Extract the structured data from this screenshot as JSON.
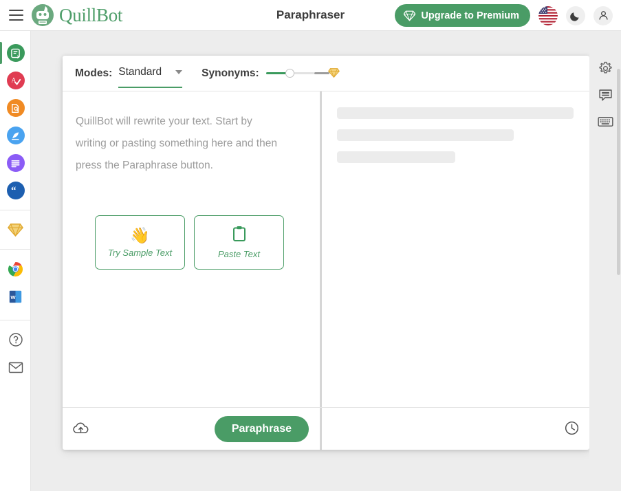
{
  "topbar": {
    "menu_icon": "hamburger-menu-icon",
    "brand_name": "QuillBot",
    "brand_logo_icon": "quillbot-robot-logo-icon",
    "page_title": "Paraphraser",
    "upgrade_label": "Upgrade to Premium",
    "upgrade_icon": "diamond-icon",
    "flag_icon": "us-flag-icon",
    "theme_icon": "moon-icon",
    "account_icon": "person-icon",
    "accent_green": "#4a9c66"
  },
  "sidebar": {
    "items": [
      {
        "name": "paraphraser",
        "icon": "paraphraser-icon",
        "color": "#3a9a5c",
        "active": true
      },
      {
        "name": "grammar-checker",
        "icon": "grammar-check-icon",
        "color": "#e03c52",
        "active": false
      },
      {
        "name": "plagiarism-checker",
        "icon": "plagiarism-search-icon",
        "color": "#f08a23",
        "active": false
      },
      {
        "name": "co-writer",
        "icon": "quill-pen-icon",
        "color": "#4aa3f0",
        "active": false
      },
      {
        "name": "summarizer",
        "icon": "summarizer-lines-icon",
        "color": "#8b5cf6",
        "active": false
      },
      {
        "name": "citation-generator",
        "icon": "quotation-marks-icon",
        "color": "#1d5fb0",
        "active": false
      }
    ],
    "premium": {
      "name": "premium",
      "icon": "gold-diamond-icon",
      "color": "#e8b32a"
    },
    "apps": [
      {
        "name": "chrome-extension",
        "icon": "chrome-icon"
      },
      {
        "name": "word-addin",
        "icon": "microsoft-word-icon"
      }
    ],
    "bottom": [
      {
        "name": "help",
        "icon": "help-circle-icon"
      },
      {
        "name": "contact",
        "icon": "envelope-icon"
      }
    ]
  },
  "toolbar": {
    "modes_label": "Modes:",
    "mode_value": "Standard",
    "mode_chevron_icon": "chevron-down-icon",
    "synonyms_label": "Synonyms:",
    "synonyms_gem_icon": "gold-diamond-icon",
    "synonyms_level": 30
  },
  "editor": {
    "placeholder": "QuillBot will rewrite your text. Start by writing or pasting something here and then press the Paraphrase button.",
    "quick_actions": [
      {
        "name": "try-sample-text",
        "label": "Try Sample Text",
        "icon": "waving-hand-icon",
        "glyph": "👋"
      },
      {
        "name": "paste-text",
        "label": "Paste Text",
        "icon": "clipboard-icon"
      }
    ]
  },
  "output": {
    "skeleton_rows": 3
  },
  "footer": {
    "upload_icon": "cloud-upload-icon",
    "paraphrase_label": "Paraphrase",
    "history_icon": "clock-history-icon"
  },
  "right_rail": {
    "items": [
      {
        "name": "settings",
        "icon": "gear-icon"
      },
      {
        "name": "feedback",
        "icon": "comment-bubble-icon"
      },
      {
        "name": "keyboard-shortcuts",
        "icon": "keyboard-icon"
      }
    ]
  }
}
